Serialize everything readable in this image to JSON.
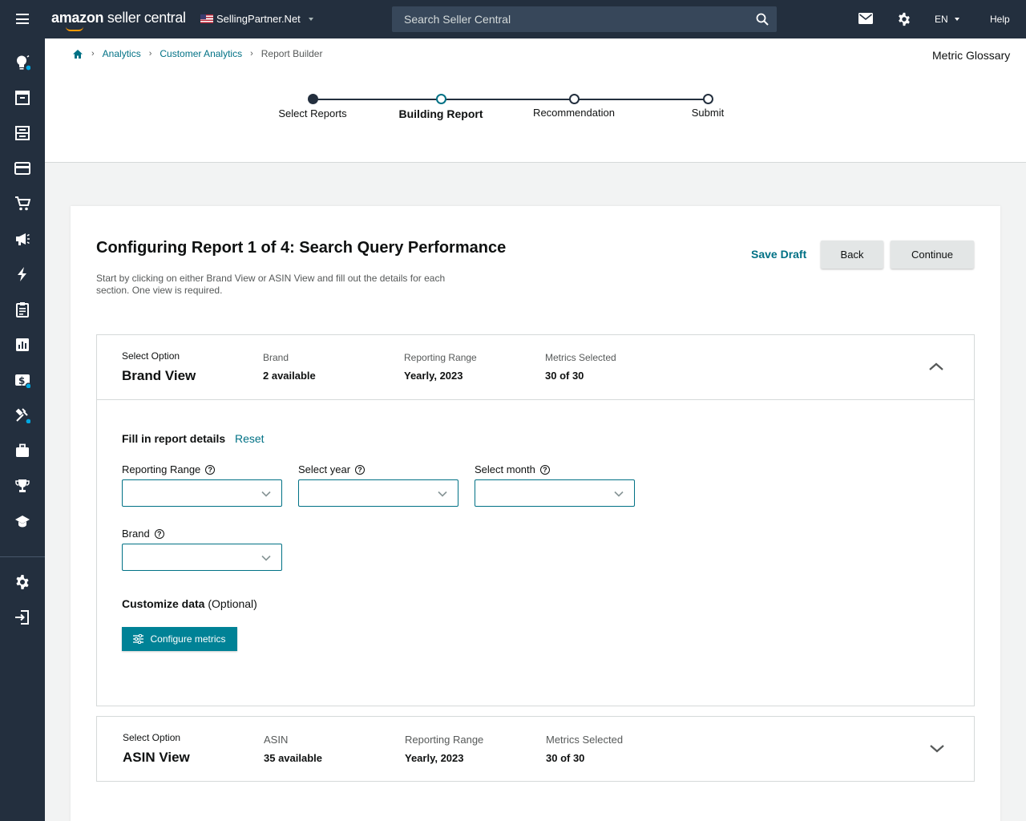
{
  "topbar": {
    "logo_main": "amazon",
    "logo_sub": " seller central",
    "marketplace": "SellingPartner.Net",
    "search_placeholder": "Search Seller Central",
    "language": "EN",
    "help": "Help"
  },
  "breadcrumb": {
    "items": [
      "Analytics",
      "Customer Analytics"
    ],
    "current": "Report Builder"
  },
  "glossary": "Metric Glossary",
  "stepper": {
    "steps": [
      "Select Reports",
      "Building Report",
      "Recommendation",
      "Submit"
    ],
    "active_index": 1
  },
  "card": {
    "title": "Configuring Report 1 of 4: Search Query Performance",
    "description": "Start by clicking on either Brand View or ASIN View and fill out the details for each section. One view is required.",
    "save_draft": "Save Draft",
    "back": "Back",
    "continue": "Continue"
  },
  "brand_section": {
    "option_label": "Select Option",
    "title": "Brand View",
    "col1_label": "Brand",
    "col1_value": "2 available",
    "col2_label": "Reporting Range",
    "col2_value": "Yearly, 2023",
    "col3_label": "Metrics Selected",
    "col3_value": "30 of 30",
    "expanded": true,
    "fill_title": "Fill in report details",
    "reset": "Reset",
    "fields": [
      "Reporting Range",
      "Select year",
      "Select month",
      "Brand"
    ],
    "customize_label": "Customize data",
    "customize_optional": "(Optional)",
    "configure_button": "Configure metrics"
  },
  "asin_section": {
    "option_label": "Select Option",
    "title": "ASIN View",
    "col1_label": "ASIN",
    "col1_value": "35 available",
    "col2_label": "Reporting Range",
    "col2_value": "Yearly, 2023",
    "col3_label": "Metrics Selected",
    "col3_value": "30 of 30",
    "expanded": false
  },
  "colors": {
    "topbar": "#232f3e",
    "link": "#007185",
    "primary_button": "#008296",
    "accent": "#ff9900"
  }
}
